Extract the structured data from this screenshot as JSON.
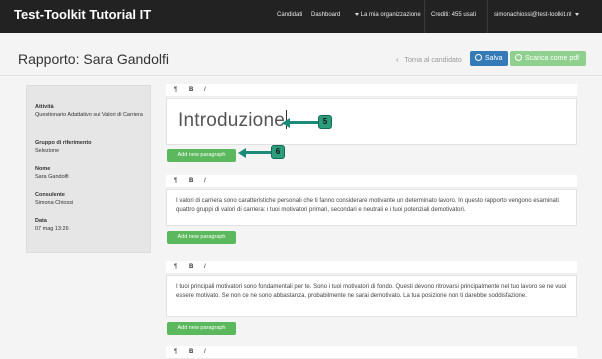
{
  "navbar": {
    "brand": "Test-Toolkit Tutorial IT",
    "links": [
      "Candidati",
      "Dashboard",
      "La mia organizzazione"
    ],
    "credits": "Crediti: 455 usati",
    "user": "simonachiossi@test-toolkit.nl"
  },
  "header": {
    "title": "Rapporto: Sara Gandolfi",
    "back_link": "Torna al candidato",
    "save_label": "Salva",
    "download_label": "Scarica come pdf"
  },
  "info": {
    "activity_label": "Attività",
    "activity_value": "Questionario Adattativo sui Valori di Carriera",
    "group_label": "Gruppo di riferimento",
    "group_value": "Selezione",
    "name_label": "Nome",
    "name_value": "Sara Gandolfi",
    "consultant_label": "Consulente",
    "consultant_value": "Simona Chiossi",
    "date_label": "Data",
    "date_value": "07 mag 13:26"
  },
  "toolbar": {
    "paragraph": "¶",
    "bold": "B",
    "italic": "I"
  },
  "editor": {
    "intro": "Introduzione",
    "add_label": "Add new paragraph",
    "para1": "I valori di carriera sono caratteristiche personali che ti fanno considerare motivante un determinato lavoro. In questo rapporto vengono esaminati quattro gruppi di valori di carriera: i tuoi motivatori primari, secondari e neutrali e i tuoi potenziali demotivatori.",
    "para2": "I tuoi principali motivatori sono fondamentali per te. Sono i tuoi motivatori di fondo. Questi devono ritrovarsi principalmente nel tuo lavoro se ne vuoi essere motivato. Se non ce ne sono abbastanza, probabilmente ne sarai demotivato. La tua posizione non ti darebbe soddisfazione."
  },
  "callouts": {
    "five": "5",
    "six": "6"
  },
  "colors": {
    "navbar": "#222222",
    "primary": "#337ab7",
    "success": "#5cb85c",
    "callout": "#2d9c7a"
  }
}
